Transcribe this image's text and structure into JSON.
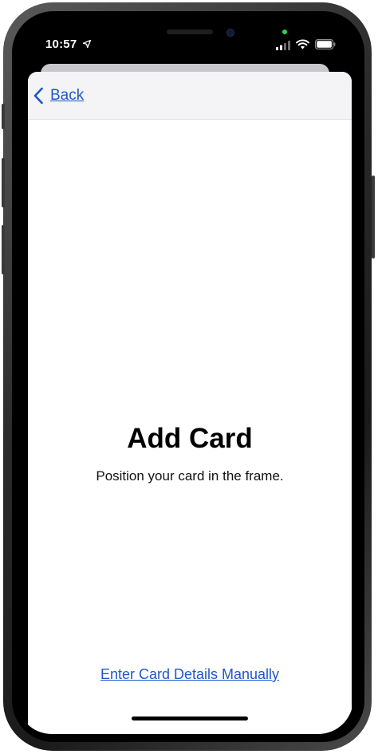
{
  "status_bar": {
    "time": "10:57",
    "icons": [
      "location-arrow-icon",
      "cellular-signal-icon",
      "wifi-icon",
      "battery-icon"
    ]
  },
  "nav": {
    "back_label": "Back",
    "back_icon": "chevron-left-icon"
  },
  "content": {
    "title": "Add Card",
    "subtitle": "Position your card in the frame.",
    "manual_link": "Enter Card Details Manually"
  },
  "colors": {
    "link": "#1f57c9",
    "nav_background": "#f4f4f6",
    "privacy_indicator": "#30d158",
    "screen_background": "#000000"
  }
}
